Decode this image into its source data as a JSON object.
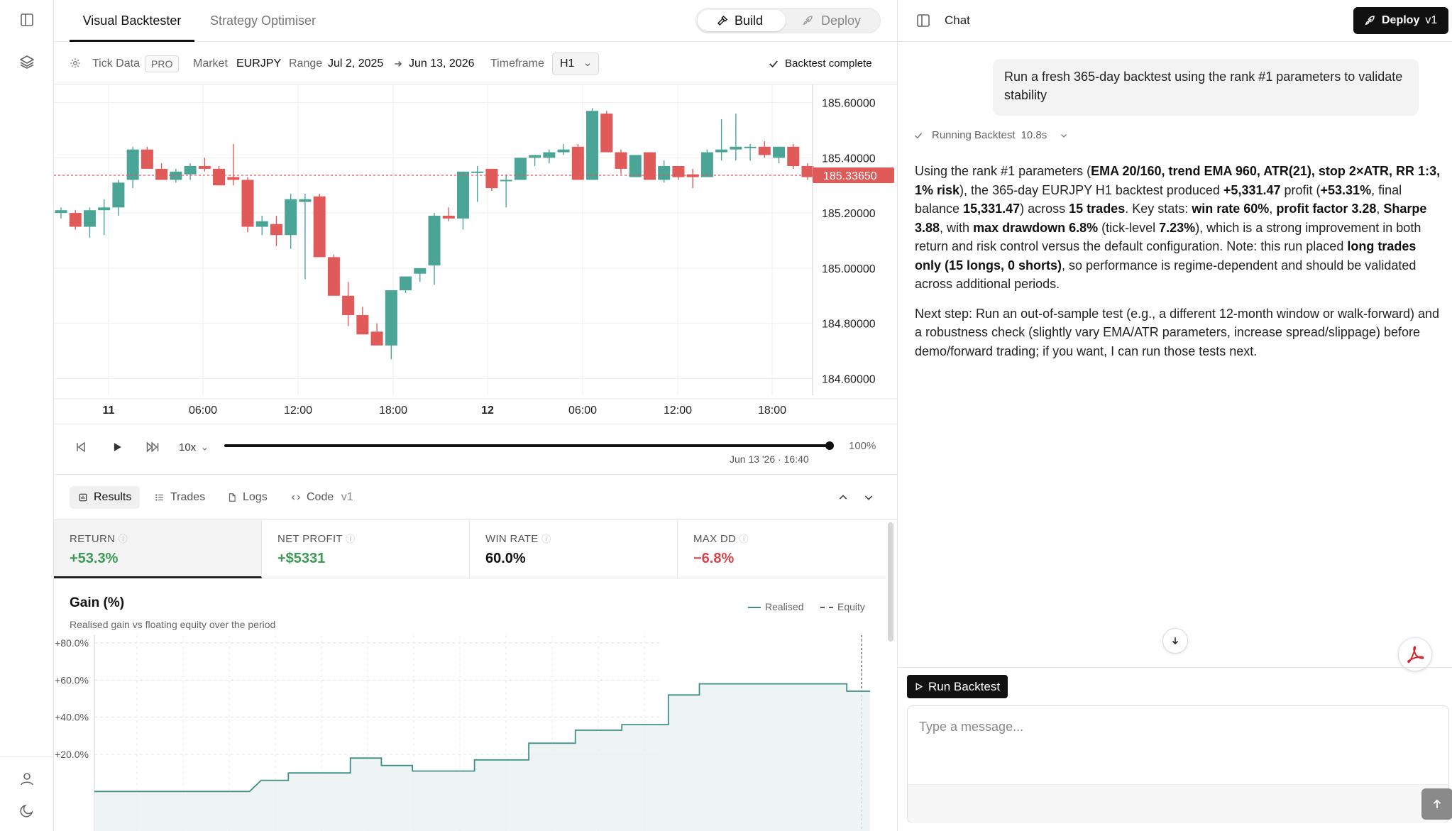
{
  "header": {
    "tabs": [
      "Visual Backtester",
      "Strategy Optimiser"
    ],
    "active_tab": 0,
    "mode": {
      "build": "Build",
      "deploy": "Deploy"
    }
  },
  "toolbar": {
    "tick_data": "Tick Data",
    "pro_badge": "PRO",
    "market_label": "Market",
    "market_value": "EURJPY",
    "range_label": "Range",
    "range_start": "Jul 2, 2025",
    "range_end": "Jun 13, 2026",
    "timeframe_label": "Timeframe",
    "timeframe_value": "H1",
    "status": "Backtest complete"
  },
  "price_chart": {
    "current_price": "185.33650",
    "y_ticks": [
      "185.60000",
      "185.40000",
      "185.20000",
      "185.00000",
      "184.80000",
      "184.60000"
    ],
    "x_ticks": [
      "11",
      "06:00",
      "12:00",
      "18:00",
      "12",
      "06:00",
      "12:00",
      "18:00"
    ],
    "colors": {
      "up": "#4ba596",
      "down": "#e05a5a"
    },
    "candles": [
      [
        185.2,
        185.22,
        185.18,
        185.21
      ],
      [
        185.2,
        185.21,
        185.14,
        185.15
      ],
      [
        185.15,
        185.22,
        185.11,
        185.21
      ],
      [
        185.21,
        185.25,
        185.12,
        185.22
      ],
      [
        185.22,
        185.32,
        185.19,
        185.31
      ],
      [
        185.32,
        185.44,
        185.29,
        185.43
      ],
      [
        185.43,
        185.44,
        185.36,
        185.36
      ],
      [
        185.36,
        185.38,
        185.32,
        185.32
      ],
      [
        185.32,
        185.36,
        185.31,
        185.35
      ],
      [
        185.34,
        185.38,
        185.32,
        185.37
      ],
      [
        185.37,
        185.4,
        185.35,
        185.36
      ],
      [
        185.36,
        185.37,
        185.3,
        185.3
      ],
      [
        185.33,
        185.45,
        185.3,
        185.32
      ],
      [
        185.32,
        185.33,
        185.13,
        185.15
      ],
      [
        185.15,
        185.19,
        185.12,
        185.17
      ],
      [
        185.16,
        185.19,
        185.08,
        185.12
      ],
      [
        185.12,
        185.27,
        185.07,
        185.25
      ],
      [
        185.24,
        185.27,
        184.96,
        185.25
      ],
      [
        185.26,
        185.27,
        185.04,
        185.04
      ],
      [
        185.04,
        185.05,
        184.93,
        184.9
      ],
      [
        184.9,
        184.95,
        184.79,
        184.83
      ],
      [
        184.83,
        184.86,
        184.76,
        184.76
      ],
      [
        184.77,
        184.8,
        184.72,
        184.72
      ],
      [
        184.72,
        184.92,
        184.67,
        184.92
      ],
      [
        184.92,
        184.97,
        184.91,
        184.97
      ],
      [
        184.98,
        185.0,
        184.95,
        185.0
      ],
      [
        185.01,
        185.2,
        184.94,
        185.19
      ],
      [
        185.19,
        185.22,
        185.17,
        185.18
      ],
      [
        185.18,
        185.35,
        185.14,
        185.35
      ],
      [
        185.35,
        185.37,
        185.24,
        185.35
      ],
      [
        185.36,
        185.36,
        185.28,
        185.29
      ],
      [
        185.32,
        185.34,
        185.22,
        185.32
      ],
      [
        185.32,
        185.4,
        185.32,
        185.4
      ],
      [
        185.4,
        185.41,
        185.37,
        185.41
      ],
      [
        185.4,
        185.43,
        185.38,
        185.42
      ],
      [
        185.42,
        185.45,
        185.41,
        185.43
      ],
      [
        185.44,
        185.45,
        185.32,
        185.32
      ],
      [
        185.32,
        185.58,
        185.32,
        185.57
      ],
      [
        185.56,
        185.57,
        185.42,
        185.42
      ],
      [
        185.42,
        185.43,
        185.34,
        185.36
      ],
      [
        185.33,
        185.39,
        185.33,
        185.41
      ],
      [
        185.42,
        185.42,
        185.33,
        185.32
      ],
      [
        185.32,
        185.39,
        185.31,
        185.37
      ],
      [
        185.37,
        185.37,
        185.32,
        185.33
      ],
      [
        185.34,
        185.36,
        185.29,
        185.33
      ],
      [
        185.33,
        185.43,
        185.34,
        185.42
      ],
      [
        185.42,
        185.54,
        185.39,
        185.43
      ],
      [
        185.43,
        185.56,
        185.39,
        185.44
      ],
      [
        185.44,
        185.45,
        185.39,
        185.44
      ],
      [
        185.44,
        185.46,
        185.4,
        185.41
      ],
      [
        185.4,
        185.44,
        185.38,
        185.44
      ],
      [
        185.44,
        185.45,
        185.36,
        185.37
      ],
      [
        185.37,
        185.38,
        185.32,
        185.33
      ]
    ]
  },
  "playback": {
    "speed": "10x",
    "progress_pct": 100,
    "progress_label": "100%",
    "timestamp": "Jun 13 '26 · 16:40"
  },
  "results_tabs": [
    "Results",
    "Trades",
    "Logs",
    "Code"
  ],
  "code_version": "v1",
  "metrics": [
    {
      "label": "RETURN",
      "value": "+53.3%",
      "tone": "pos"
    },
    {
      "label": "NET PROFIT",
      "value": "+$5331",
      "tone": "pos"
    },
    {
      "label": "WIN RATE",
      "value": "60.0%",
      "tone": "neu"
    },
    {
      "label": "MAX DD",
      "value": "−6.8%",
      "tone": "neg"
    }
  ],
  "gain": {
    "title": "Gain (%)",
    "subtitle": "Realised gain vs floating equity over the period",
    "legend_realised": "Realised",
    "legend_equity": "Equity",
    "y_ticks": [
      "+80.0%",
      "+60.0%",
      "+40.0%",
      "+20.0%"
    ],
    "chart_data": {
      "type": "area",
      "series": [
        {
          "name": "Realised",
          "values": [
            [
              0,
              0
            ],
            [
              0.2,
              0
            ],
            [
              0.215,
              6
            ],
            [
              0.25,
              6
            ],
            [
              0.25,
              10
            ],
            [
              0.33,
              10
            ],
            [
              0.33,
              18
            ],
            [
              0.37,
              18
            ],
            [
              0.37,
              14
            ],
            [
              0.41,
              14
            ],
            [
              0.41,
              11
            ],
            [
              0.49,
              11
            ],
            [
              0.49,
              17
            ],
            [
              0.56,
              17
            ],
            [
              0.56,
              26
            ],
            [
              0.62,
              26
            ],
            [
              0.62,
              33
            ],
            [
              0.68,
              33
            ],
            [
              0.68,
              36
            ],
            [
              0.74,
              36
            ],
            [
              0.74,
              52
            ],
            [
              0.78,
              52
            ],
            [
              0.78,
              58
            ],
            [
              0.86,
              58
            ],
            [
              0.86,
              58
            ],
            [
              0.97,
              58
            ],
            [
              0.97,
              54
            ],
            [
              1.0,
              54
            ]
          ]
        }
      ],
      "ylim": [
        0,
        80
      ]
    }
  },
  "chat": {
    "title": "Chat",
    "deploy": "Deploy",
    "deploy_version": "v1",
    "user_message": "Run a fresh 365-day backtest using the rank #1 parameters to validate stability",
    "status": "Running Backtest",
    "status_time": "10.8s",
    "p1": [
      [
        "n",
        "Using the rank #1 parameters ("
      ],
      [
        "b",
        "EMA 20/160, trend EMA 960, ATR(21), stop 2×ATR, RR 1:3, 1% risk"
      ],
      [
        "n",
        "), the 365-day EURJPY H1 backtest produced "
      ],
      [
        "b",
        "+5,331.47"
      ],
      [
        "n",
        " profit ("
      ],
      [
        "b",
        "+53.31%"
      ],
      [
        "n",
        ", final balance "
      ],
      [
        "b",
        "15,331.47"
      ],
      [
        "n",
        ") across "
      ],
      [
        "b",
        "15 trades"
      ],
      [
        "n",
        ". Key stats: "
      ],
      [
        "b",
        "win rate 60%"
      ],
      [
        "n",
        ", "
      ],
      [
        "b",
        "profit factor 3.28"
      ],
      [
        "n",
        ", "
      ],
      [
        "b",
        "Sharpe 3.88"
      ],
      [
        "n",
        ", with "
      ],
      [
        "b",
        "max drawdown 6.8%"
      ],
      [
        "n",
        " (tick-level "
      ],
      [
        "b",
        "7.23%"
      ],
      [
        "n",
        "), which is a strong improvement in both return and risk control versus the default configuration. Note: this run placed "
      ],
      [
        "b",
        "long trades only (15 longs, 0 shorts)"
      ],
      [
        "n",
        ", so performance is regime-dependent and should be validated across additional periods."
      ]
    ],
    "p2": "Next step: Run an out-of-sample test (e.g., a different 12-month window or walk-forward) and a robustness check (slightly vary EMA/ATR parameters, increase spread/slippage) before demo/forward trading; if you want, I can run those tests next.",
    "run_backtest": "Run Backtest",
    "input_placeholder": "Type a message..."
  }
}
